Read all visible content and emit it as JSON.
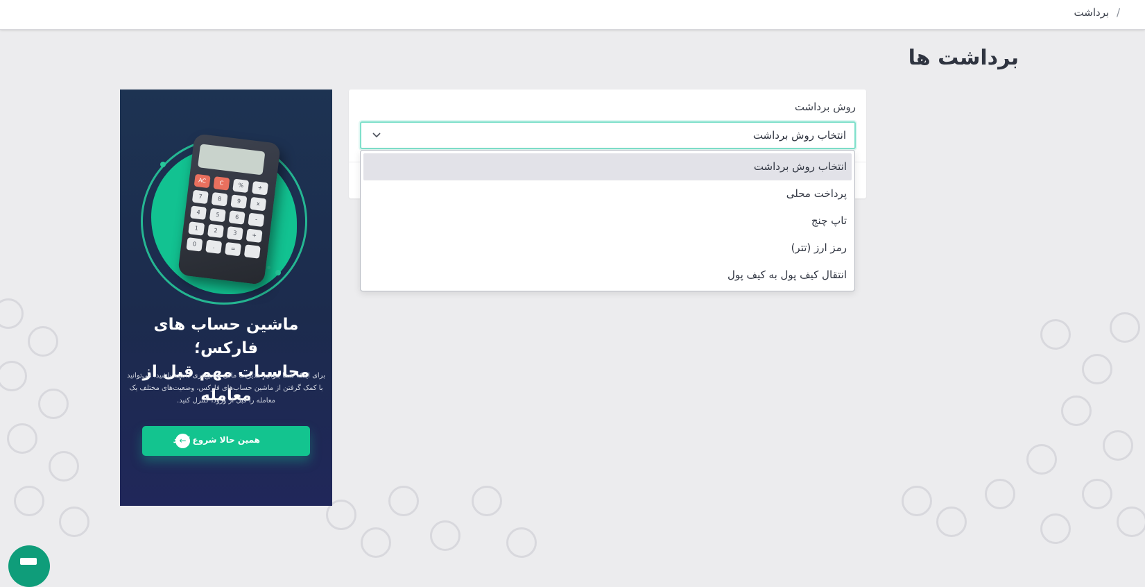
{
  "breadcrumb": {
    "separator": "/",
    "current": "برداشت"
  },
  "page": {
    "title": "برداشت ها"
  },
  "form": {
    "field_label": "روش برداشت",
    "select_value": "انتخاب روش برداشت",
    "options": [
      {
        "label": "انتخاب روش برداشت",
        "selected": true
      },
      {
        "label": "پرداخت محلی",
        "selected": false
      },
      {
        "label": "تاپ چنج",
        "selected": false
      },
      {
        "label": "رمز ارز (تتر)",
        "selected": false
      },
      {
        "label": "انتقال کیف پول به کیف پول",
        "selected": false
      }
    ]
  },
  "ad": {
    "headline_line1": "ماشین حساب های فارکس؛",
    "headline_line2": "محاسبات مهم قبل از معامله",
    "body": "برای اینکه شما بتوانید مدیریت مالی صحیح‌تری داشته باشید، می‌توانید با کمک گرفتن از ماشین حساب‌های فارکس، وضعیت‌های مختلف یک معامله را قبل از ورود، کنترل کنید.",
    "cta_label": "همین حالا شروع کنید",
    "calculator_keys": [
      "AC",
      "C",
      "%",
      "+",
      "7",
      "8",
      "9",
      "x",
      "4",
      "5",
      "6",
      "-",
      "1",
      "2",
      "3",
      "+",
      "0",
      ".",
      "=",
      ""
    ]
  },
  "colors": {
    "accent": "#13c48f",
    "focus_border": "#7fe0cb",
    "selected_option_bg": "#e2e2e8",
    "ad_bg": "#1c2b4d"
  },
  "icons": {
    "select_chevron": "chevron-down-icon",
    "cta_arrow": "arrow-left-icon",
    "chat": "chat-icon"
  }
}
